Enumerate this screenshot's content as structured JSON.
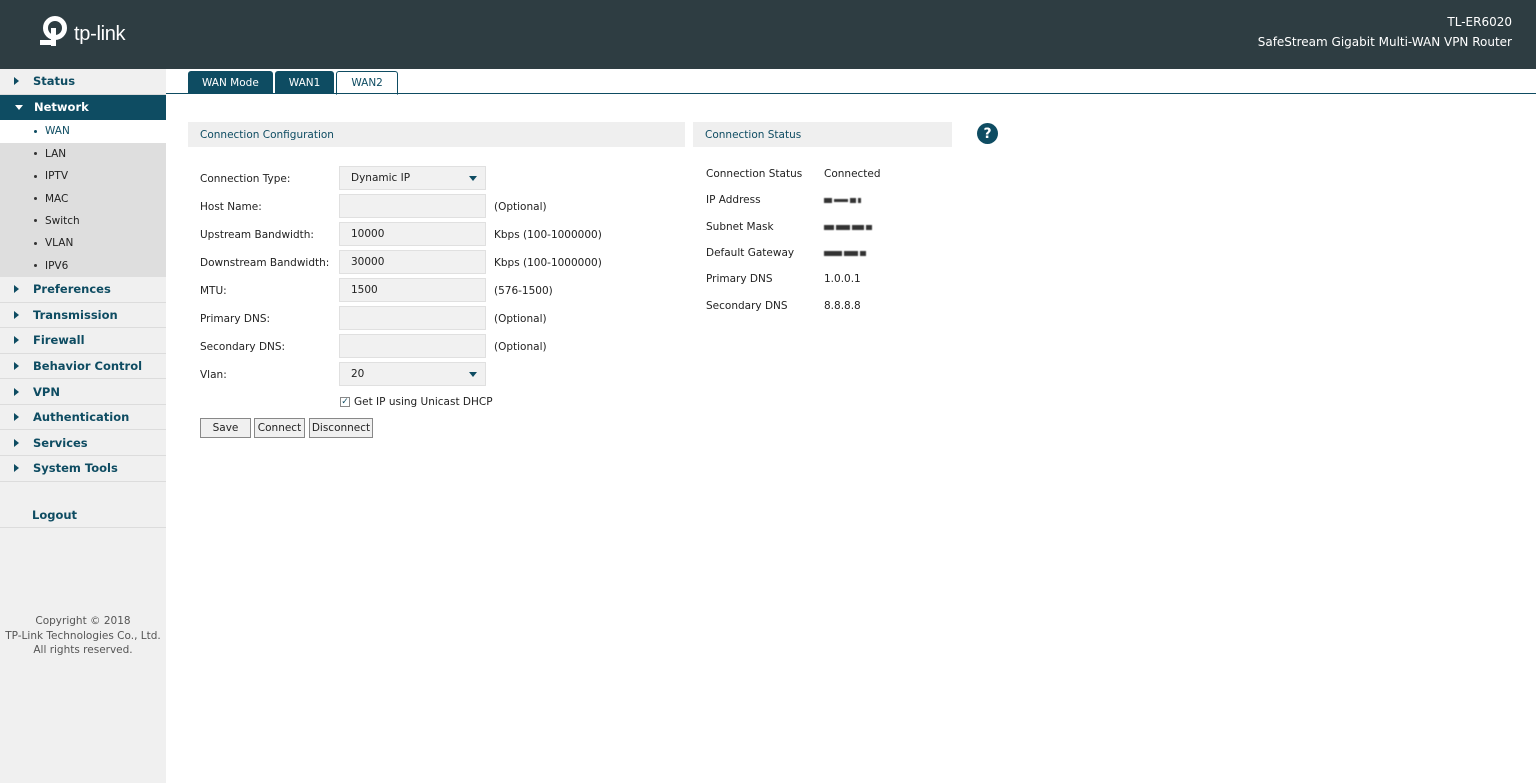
{
  "header": {
    "logo_text": "tp-link",
    "model": "TL-ER6020",
    "subtitle": "SafeStream Gigabit Multi-WAN VPN Router"
  },
  "sidebar": {
    "items": [
      {
        "label": "Status"
      },
      {
        "label": "Network"
      },
      {
        "label": "Preferences"
      },
      {
        "label": "Transmission"
      },
      {
        "label": "Firewall"
      },
      {
        "label": "Behavior Control"
      },
      {
        "label": "VPN"
      },
      {
        "label": "Authentication"
      },
      {
        "label": "Services"
      },
      {
        "label": "System Tools"
      }
    ],
    "network_sub": [
      "WAN",
      "LAN",
      "IPTV",
      "MAC",
      "Switch",
      "VLAN",
      "IPV6"
    ],
    "logout": "Logout",
    "copyright": [
      "Copyright © 2018",
      "TP-Link Technologies Co., Ltd.",
      "All rights reserved."
    ]
  },
  "tabs": [
    "WAN Mode",
    "WAN1",
    "WAN2"
  ],
  "config": {
    "title": "Connection Configuration",
    "connection_type_label": "Connection Type:",
    "connection_type_value": "Dynamic IP",
    "host_name_label": "Host Name:",
    "host_name_value": "",
    "host_name_hint": "(Optional)",
    "upstream_label": "Upstream Bandwidth:",
    "upstream_value": "10000",
    "upstream_hint": "Kbps (100-1000000)",
    "downstream_label": "Downstream Bandwidth:",
    "downstream_value": "30000",
    "downstream_hint": "Kbps (100-1000000)",
    "mtu_label": "MTU:",
    "mtu_value": "1500",
    "mtu_hint": "(576-1500)",
    "primary_dns_label": "Primary DNS:",
    "primary_dns_value": "",
    "primary_dns_hint": "(Optional)",
    "secondary_dns_label": "Secondary DNS:",
    "secondary_dns_value": "",
    "secondary_dns_hint": "(Optional)",
    "vlan_label": "Vlan:",
    "vlan_value": "20",
    "unicast_label": "Get IP using Unicast DHCP",
    "unicast_checked": true,
    "save": "Save",
    "connect": "Connect",
    "disconnect": "Disconnect"
  },
  "status": {
    "title": "Connection Status",
    "rows": [
      {
        "label": "Connection Status",
        "value": "Connected"
      },
      {
        "label": "IP Address",
        "value": ""
      },
      {
        "label": "Subnet Mask",
        "value": ""
      },
      {
        "label": "Default Gateway",
        "value": ""
      },
      {
        "label": "Primary DNS",
        "value": "1.0.0.1"
      },
      {
        "label": "Secondary DNS",
        "value": "8.8.8.8"
      }
    ]
  },
  "colors": {
    "header_bg": "#2e3d42",
    "accent": "#0e4c62",
    "sidebar_bg": "#f0f0f0"
  },
  "icons": [
    "tp-link-logo-icon",
    "help-icon",
    "caret-right-icon",
    "caret-down-icon",
    "dropdown-arrow-icon"
  ]
}
